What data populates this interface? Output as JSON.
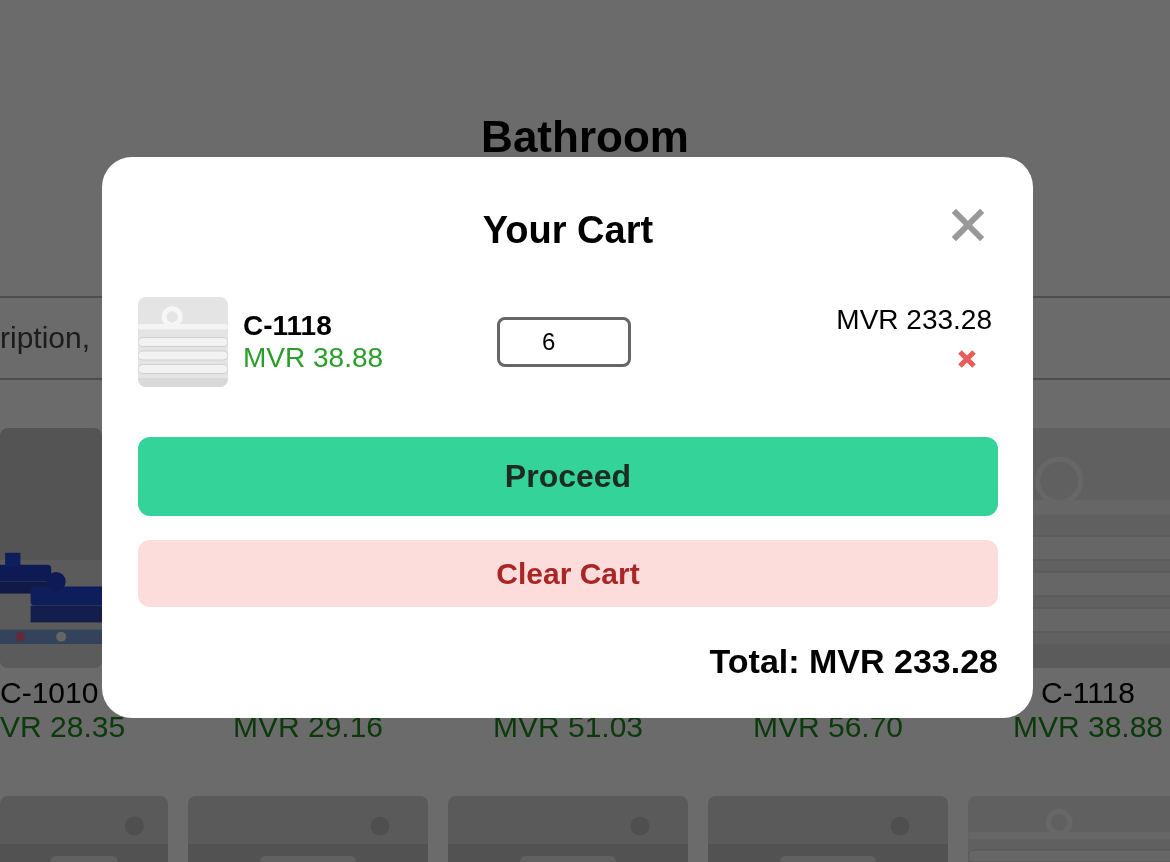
{
  "page": {
    "title": "Bathroom",
    "search": {
      "value": "ription,"
    }
  },
  "products": [
    {
      "name": "C-1010",
      "price": "VR 28.35"
    },
    {
      "price": "MVR 29.16"
    },
    {
      "price": "MVR 51.03"
    },
    {
      "price": "MVR 56.70"
    },
    {
      "name": "C-1118",
      "price": "MVR 38.88"
    }
  ],
  "cart": {
    "title": "Your Cart",
    "items": [
      {
        "name": "C-1118",
        "unit_price": "MVR 38.88",
        "quantity": "6",
        "line_total": "MVR 233.28"
      }
    ],
    "buttons": [
      {
        "kind": "proceed",
        "label": "Proceed"
      },
      {
        "kind": "clear",
        "label": "Clear Cart"
      }
    ],
    "total": "Total: MVR 233.28"
  }
}
